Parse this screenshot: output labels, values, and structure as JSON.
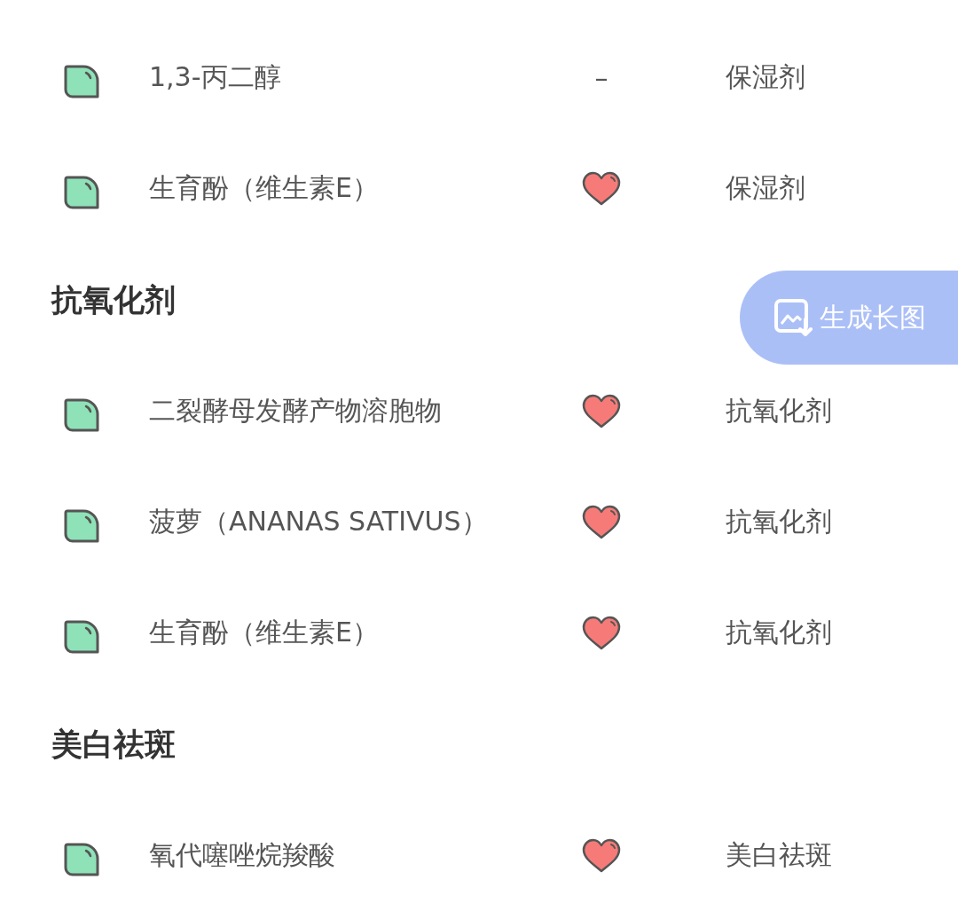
{
  "sections": [
    {
      "rows": [
        {
          "name": "1,3-丙二醇",
          "middle": {
            "kind": "text",
            "text": "–"
          },
          "function": "保湿剂"
        },
        {
          "name": "生育酚（维生素E）",
          "middle": {
            "kind": "heart"
          },
          "function": "保湿剂"
        }
      ]
    },
    {
      "heading": "抗氧化剂",
      "rows": [
        {
          "name": "二裂酵母发酵产物溶胞物",
          "middle": {
            "kind": "heart"
          },
          "function": "抗氧化剂"
        },
        {
          "name": "菠萝（ANANAS SATIVUS）",
          "middle": {
            "kind": "heart"
          },
          "function": "抗氧化剂"
        },
        {
          "name": "生育酚（维生素E）",
          "middle": {
            "kind": "heart"
          },
          "function": "抗氧化剂"
        }
      ]
    },
    {
      "heading": "美白祛斑",
      "rows": [
        {
          "name": "氧代噻唑烷羧酸",
          "middle": {
            "kind": "heart"
          },
          "function": "美白祛斑"
        }
      ]
    }
  ],
  "long_image_button": {
    "label": "生成长图"
  }
}
